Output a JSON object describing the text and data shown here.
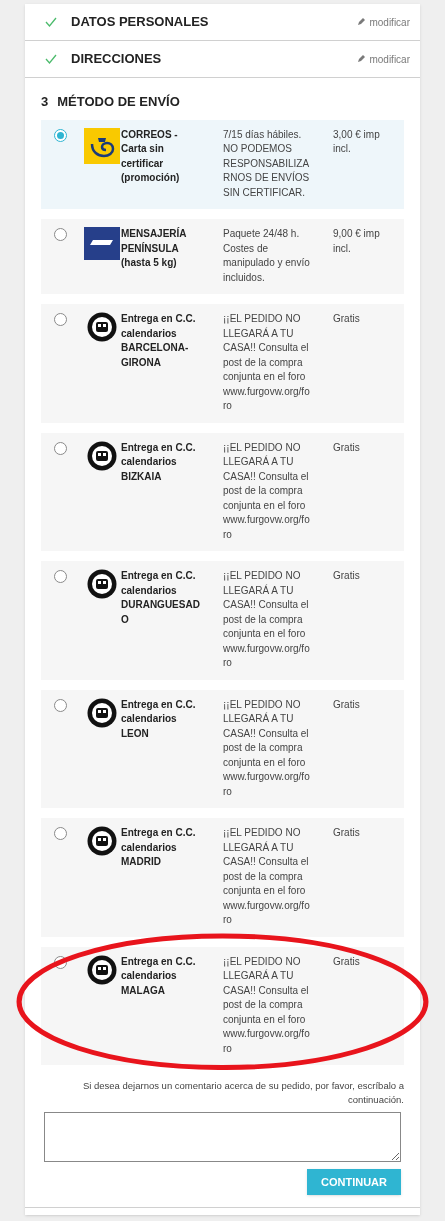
{
  "completed_steps": [
    {
      "title": "DATOS PERSONALES",
      "action": "modificar"
    },
    {
      "title": "DIRECCIONES",
      "action": "modificar"
    }
  ],
  "current_step": {
    "number": "3",
    "title": "MÉTODO DE ENVÍO"
  },
  "carriers": [
    {
      "kind": "post",
      "selected": true,
      "circled": false,
      "name": "CORREOS - Carta sin certificar (promoción)",
      "delay": "7/15 días hábiles. NO PODEMOS RESPONSABILIZARNOS DE ENVÍOS SIN CERTIFICAR.",
      "price": "3,00 € imp incl."
    },
    {
      "kind": "courier",
      "selected": false,
      "circled": false,
      "name": "MENSAJERÍA PENÍNSULA (hasta 5 kg)",
      "delay": "Paquete 24/48 h. Costes de manipulado y envío incluidos.",
      "price": "9,00 € imp incl."
    },
    {
      "kind": "club",
      "selected": false,
      "circled": false,
      "name": "Entrega en C.C. calendarios BARCELONA-GIRONA",
      "delay": "¡¡EL PEDIDO NO LLEGARÁ A TU CASA!! Consulta el post de la compra conjunta en el foro www.furgovw.org/foro",
      "price": "Gratis"
    },
    {
      "kind": "club",
      "selected": false,
      "circled": false,
      "name": "Entrega en C.C. calendarios BIZKAIA",
      "delay": "¡¡EL PEDIDO NO LLEGARÁ A TU CASA!! Consulta el post de la compra conjunta en el foro www.furgovw.org/foro",
      "price": "Gratis"
    },
    {
      "kind": "club",
      "selected": false,
      "circled": false,
      "name": "Entrega en C.C. calendarios DURANGUESADO",
      "delay": "¡¡EL PEDIDO NO LLEGARÁ A TU CASA!! Consulta el post de la compra conjunta en el foro www.furgovw.org/foro",
      "price": "Gratis"
    },
    {
      "kind": "club",
      "selected": false,
      "circled": false,
      "name": "Entrega en C.C. calendarios LEON",
      "delay": "¡¡EL PEDIDO NO LLEGARÁ A TU CASA!! Consulta el post de la compra conjunta en el foro www.furgovw.org/foro",
      "price": "Gratis"
    },
    {
      "kind": "club",
      "selected": false,
      "circled": false,
      "name": "Entrega en C.C. calendarios MADRID",
      "delay": "¡¡EL PEDIDO NO LLEGARÁ A TU CASA!! Consulta el post de la compra conjunta en el foro www.furgovw.org/foro",
      "price": "Gratis"
    },
    {
      "kind": "club",
      "selected": false,
      "circled": true,
      "name": "Entrega en C.C. calendarios MALAGA",
      "delay": "¡¡EL PEDIDO NO LLEGARÁ A TU CASA!! Consulta el post de la compra conjunta en el foro www.furgovw.org/foro",
      "price": "Gratis"
    }
  ],
  "comment": {
    "label": "Si desea dejarnos un comentario acerca de su pedido, por favor, escríbalo a continuación."
  },
  "continue_button": "CONTINUAR"
}
